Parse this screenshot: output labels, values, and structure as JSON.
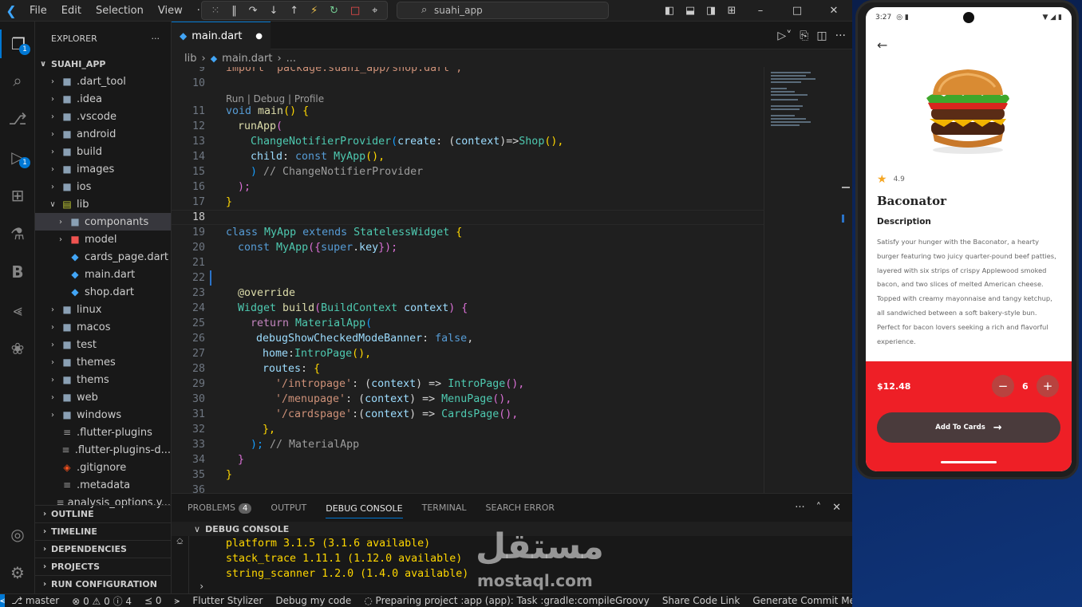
{
  "titlebar": {
    "menu": [
      "File",
      "Edit",
      "Selection",
      "View",
      "···"
    ],
    "search": "suahi_app"
  },
  "sidebar": {
    "title": "EXPLORER",
    "root": "SUAHI_APP",
    "items": [
      {
        "label": ".dart_tool",
        "type": "folder",
        "depth": 1
      },
      {
        "label": ".idea",
        "type": "folder",
        "depth": 1
      },
      {
        "label": ".vscode",
        "type": "folder",
        "depth": 1
      },
      {
        "label": "android",
        "type": "folder",
        "depth": 1
      },
      {
        "label": "build",
        "type": "folder",
        "depth": 1
      },
      {
        "label": "images",
        "type": "folder",
        "depth": 1
      },
      {
        "label": "ios",
        "type": "folder",
        "depth": 1
      },
      {
        "label": "lib",
        "type": "folder-open",
        "depth": 1
      },
      {
        "label": "componants",
        "type": "folder",
        "depth": 2,
        "selected": true
      },
      {
        "label": "model",
        "type": "folder",
        "depth": 2
      },
      {
        "label": "cards_page.dart",
        "type": "dart",
        "depth": 2
      },
      {
        "label": "main.dart",
        "type": "dart",
        "depth": 2
      },
      {
        "label": "shop.dart",
        "type": "dart",
        "depth": 2
      },
      {
        "label": "linux",
        "type": "folder",
        "depth": 1
      },
      {
        "label": "macos",
        "type": "folder",
        "depth": 1
      },
      {
        "label": "test",
        "type": "folder",
        "depth": 1
      },
      {
        "label": "themes",
        "type": "folder",
        "depth": 1
      },
      {
        "label": "thems",
        "type": "folder",
        "depth": 1
      },
      {
        "label": "web",
        "type": "folder",
        "depth": 1
      },
      {
        "label": "windows",
        "type": "folder",
        "depth": 1
      },
      {
        "label": ".flutter-plugins",
        "type": "file",
        "depth": 1
      },
      {
        "label": ".flutter-plugins-d...",
        "type": "file",
        "depth": 1
      },
      {
        "label": ".gitignore",
        "type": "git",
        "depth": 1
      },
      {
        "label": ".metadata",
        "type": "file",
        "depth": 1
      },
      {
        "label": "analysis_options.y...",
        "type": "file",
        "depth": 1
      }
    ],
    "sections": [
      "OUTLINE",
      "TIMELINE",
      "DEPENDENCIES",
      "PROJECTS",
      "RUN CONFIGURATION"
    ],
    "activity_badges": {
      "explorer": "1",
      "debug": "1"
    }
  },
  "editor": {
    "tab": "main.dart",
    "breadcrumb": [
      "lib",
      "main.dart",
      "..."
    ],
    "codelens": "Run | Debug | Profile",
    "line_numbers": [
      "9",
      "10",
      "11",
      "12",
      "13",
      "14",
      "15",
      "16",
      "17",
      "18",
      "19",
      "20",
      "21",
      "22",
      "23",
      "24",
      "25",
      "26",
      "27",
      "28",
      "29",
      "30",
      "31",
      "32",
      "33",
      "34",
      "35",
      "36"
    ],
    "current_line": "18",
    "code": {
      "l9": "import 'package:suahi_app/shop.dart';",
      "l11a": "void ",
      "l11b": "main",
      "l11c": "() {",
      "l12a": "runApp",
      "l12b": "(",
      "l13a": "ChangeNotifierProvider",
      "l13b": "(",
      "l13c": "create",
      "l13d": ": (",
      "l13e": "context",
      "l13f": ")=>",
      "l13g": "Shop",
      "l13h": "(),",
      "l14a": "child",
      "l14b": ": ",
      "l14c": "const ",
      "l14d": "MyApp",
      "l14e": "(),",
      "l15a": ") ",
      "l15b": "// ChangeNotifierProvider",
      "l16": ");",
      "l17": "}",
      "l19a": "class ",
      "l19b": "MyApp ",
      "l19c": "extends ",
      "l19d": "StatelessWidget ",
      "l19e": "{",
      "l20a": "const ",
      "l20b": "MyApp",
      "l20c": "({",
      "l20d": "super",
      "l20e": ".",
      "l20f": "key",
      "l20g": "});",
      "l23": "@override",
      "l24a": "Widget ",
      "l24b": "build",
      "l24c": "(",
      "l24d": "BuildContext ",
      "l24e": "context",
      "l24f": ") {",
      "l25a": "return ",
      "l25b": "MaterialApp",
      "l25c": "(",
      "l26a": "debugShowCheckedModeBanner",
      "l26b": ": ",
      "l26c": "false",
      "l26d": ",",
      "l27a": "home",
      "l27b": ":",
      "l27c": "IntroPage",
      "l27d": "(),",
      "l28a": "routes",
      "l28b": ": ",
      "l28c": "{",
      "l29a": "'/intropage'",
      "l29b": ": (",
      "l29c": "context",
      "l29d": ") => ",
      "l29e": "IntroPage",
      "l29f": "(),",
      "l30a": "'/menupage'",
      "l30b": ": (",
      "l30c": "context",
      "l30d": ") => ",
      "l30e": "MenuPage",
      "l30f": "(),",
      "l31a": "'/cardspage'",
      "l31b": ":(",
      "l31c": "context",
      "l31d": ") => ",
      "l31e": "CardsPage",
      "l31f": "(),",
      "l32": "},",
      "l33a": "); ",
      "l33b": "// MaterialApp",
      "l34": "}",
      "l35": "}"
    }
  },
  "panel": {
    "tabs": [
      "PROBLEMS",
      "OUTPUT",
      "DEBUG CONSOLE",
      "TERMINAL",
      "SEARCH ERROR"
    ],
    "problems_count": "4",
    "console_title": "DEBUG CONSOLE",
    "lines": [
      "platform 3.1.5 (3.1.6 available)",
      "stack_trace 1.11.1 (1.12.0 available)",
      "string_scanner 1.2.0 (1.4.0 available)"
    ]
  },
  "statusbar": {
    "branch": "master",
    "errors": "0",
    "warnings": "0",
    "info": "4",
    "ports": "0",
    "items": [
      "Flutter Stylizer",
      "Debug my code",
      "Preparing project :app (app): Task :gradle:compileGroovy",
      "Share Code Link",
      "Generate Commit Message"
    ]
  },
  "phone": {
    "time": "3:27",
    "rating": "4.9",
    "name": "Baconator",
    "desc_title": "Description",
    "description": " Satisfy your hunger with the Baconator, a hearty burger featuring two juicy quarter-pound beef patties, layered with six strips of crispy Applewood smoked bacon, and two slices of melted American cheese. Topped with creamy mayonnaise and tangy ketchup, all sandwiched between a soft bakery-style bun. Perfect for bacon lovers seeking a rich and flavorful experience.",
    "price": "$12.48",
    "qty": "6",
    "add_button": "Add To Cards",
    "accent": "#ee1f26"
  },
  "watermark": {
    "ar": "مستقل",
    "en": "mostaql.com"
  }
}
